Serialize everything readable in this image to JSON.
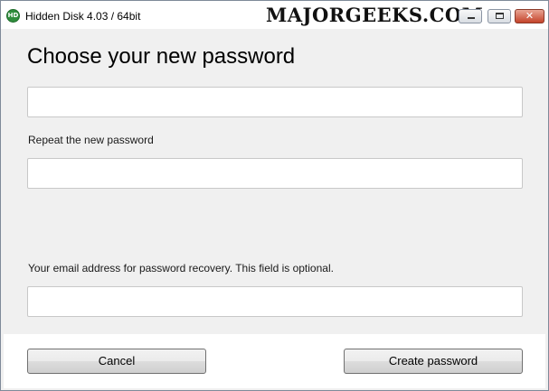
{
  "window": {
    "title": "Hidden Disk 4.03 / 64bit",
    "app_icon_text": "HD",
    "watermark": "MAJORGEEKS.COM",
    "controls": {
      "close_glyph": "✕"
    }
  },
  "form": {
    "heading": "Choose your new password",
    "new_password": {
      "value": "",
      "placeholder": ""
    },
    "repeat_label": "Repeat the new password",
    "repeat_password": {
      "value": "",
      "placeholder": ""
    },
    "email_label": "Your email address for password recovery. This field is optional.",
    "email": {
      "value": "",
      "placeholder": ""
    }
  },
  "buttons": {
    "cancel": "Cancel",
    "create": "Create password"
  },
  "colors": {
    "app_icon": "#2f8d3c",
    "close_button": "#c4432a",
    "content_background": "#f0f0f0",
    "footer_background": "#ffffff"
  }
}
